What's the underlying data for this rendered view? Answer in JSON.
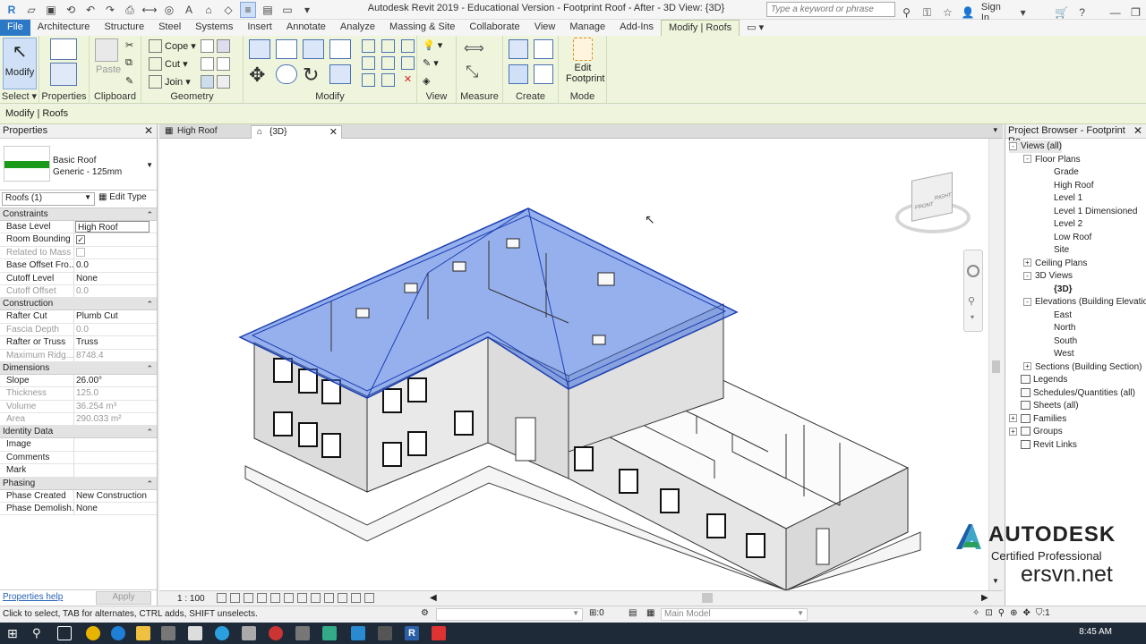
{
  "title_bar": {
    "title": "Autodesk Revit 2019 - Educational Version - Footprint Roof - After - 3D View: {3D}",
    "search_placeholder": "Type a keyword or phrase",
    "sign_in": "Sign In"
  },
  "ribbon_tabs": [
    "File",
    "Architecture",
    "Structure",
    "Steel",
    "Systems",
    "Insert",
    "Annotate",
    "Analyze",
    "Massing & Site",
    "Collaborate",
    "View",
    "Manage",
    "Add-Ins",
    "Modify | Roofs"
  ],
  "ribbon": {
    "modify_label": "Modify",
    "select_label": "Select",
    "properties_label": "Properties",
    "paste_label": "Paste",
    "clipboard_label": "Clipboard",
    "cope_label": "Cope",
    "cut_label": "Cut",
    "join_label": "Join",
    "geometry_label": "Geometry",
    "modify_panel_label": "Modify",
    "view_label": "View",
    "measure_label": "Measure",
    "create_label": "Create",
    "edit_footprint_label": "Edit Footprint",
    "mode_label": "Mode"
  },
  "options_bar": {
    "context": "Modify | Roofs"
  },
  "properties": {
    "title": "Properties",
    "type_family": "Basic Roof",
    "type_name": "Generic - 125mm",
    "instance_selector": "Roofs (1)",
    "edit_type": "Edit Type",
    "help_link": "Properties help",
    "apply": "Apply",
    "groups": [
      {
        "name": "Constraints",
        "rows": [
          {
            "key": "Base Level",
            "value": "High Roof",
            "dim": false,
            "edit": true
          },
          {
            "key": "Room Bounding",
            "value": "",
            "check": "on",
            "dim": false
          },
          {
            "key": "Related to Mass",
            "value": "",
            "check": "off",
            "dim": true
          },
          {
            "key": "Base Offset Fro...",
            "value": "0.0",
            "dim": false
          },
          {
            "key": "Cutoff Level",
            "value": "None",
            "dim": false
          },
          {
            "key": "Cutoff Offset",
            "value": "0.0",
            "dim": true
          }
        ]
      },
      {
        "name": "Construction",
        "rows": [
          {
            "key": "Rafter Cut",
            "value": "Plumb Cut",
            "dim": false
          },
          {
            "key": "Fascia Depth",
            "value": "0.0",
            "dim": true
          },
          {
            "key": "Rafter or Truss",
            "value": "Truss",
            "dim": false
          },
          {
            "key": "Maximum Ridg...",
            "value": "8748.4",
            "dim": true
          }
        ]
      },
      {
        "name": "Dimensions",
        "rows": [
          {
            "key": "Slope",
            "value": "26.00°",
            "dim": false
          },
          {
            "key": "Thickness",
            "value": "125.0",
            "dim": true
          },
          {
            "key": "Volume",
            "value": "36.254 m³",
            "dim": true
          },
          {
            "key": "Area",
            "value": "290.033 m²",
            "dim": true
          }
        ]
      },
      {
        "name": "Identity Data",
        "rows": [
          {
            "key": "Image",
            "value": "",
            "dim": false
          },
          {
            "key": "Comments",
            "value": "",
            "dim": false
          },
          {
            "key": "Mark",
            "value": "",
            "dim": false
          }
        ]
      },
      {
        "name": "Phasing",
        "rows": [
          {
            "key": "Phase Created",
            "value": "New Construction",
            "dim": false
          },
          {
            "key": "Phase Demolish...",
            "value": "None",
            "dim": false
          }
        ]
      }
    ]
  },
  "view_tabs": [
    {
      "label": "High Roof",
      "active": false
    },
    {
      "label": "{3D}",
      "active": true
    }
  ],
  "view_controls": {
    "scale": "1 : 100"
  },
  "viewcube": {
    "front": "FRONT",
    "right": "RIGHT"
  },
  "project_browser": {
    "title": "Project Browser - Footprint Ro...",
    "items": [
      {
        "label": "Views (all)",
        "level": 0,
        "pm": "-",
        "sel": true
      },
      {
        "label": "Floor Plans",
        "level": 1,
        "pm": "-"
      },
      {
        "label": "Grade",
        "level": 2
      },
      {
        "label": "High Roof",
        "level": 2
      },
      {
        "label": "Level 1",
        "level": 2
      },
      {
        "label": "Level 1 Dimensioned",
        "level": 2
      },
      {
        "label": "Level 2",
        "level": 2
      },
      {
        "label": "Low Roof",
        "level": 2
      },
      {
        "label": "Site",
        "level": 2
      },
      {
        "label": "Ceiling Plans",
        "level": 1,
        "pm": "+"
      },
      {
        "label": "3D Views",
        "level": 1,
        "pm": "-"
      },
      {
        "label": "{3D}",
        "level": 2,
        "bold": true
      },
      {
        "label": "Elevations (Building Elevation)",
        "level": 1,
        "pm": "-"
      },
      {
        "label": "East",
        "level": 2
      },
      {
        "label": "North",
        "level": 2
      },
      {
        "label": "South",
        "level": 2
      },
      {
        "label": "West",
        "level": 2
      },
      {
        "label": "Sections (Building Section)",
        "level": 1,
        "pm": "+"
      },
      {
        "label": "Legends",
        "level": 0,
        "icon": true
      },
      {
        "label": "Schedules/Quantities (all)",
        "level": 0,
        "icon": true
      },
      {
        "label": "Sheets (all)",
        "level": 0,
        "icon": true
      },
      {
        "label": "Families",
        "level": 0,
        "pm": "+",
        "icon": true
      },
      {
        "label": "Groups",
        "level": 0,
        "pm": "+",
        "icon": true
      },
      {
        "label": "Revit Links",
        "level": 0,
        "icon": true
      }
    ]
  },
  "status_bar": {
    "text": "Click to select, TAB for alternates, CTRL adds, SHIFT unselects.",
    "selection_count": ":0",
    "model": "Main Model",
    "filter": ":1"
  },
  "taskbar": {
    "clock": "8:45 AM"
  },
  "watermark": {
    "brand": "AUTODESK",
    "subtitle": "Certified Professional",
    "site": "ersvn.net"
  },
  "colors": {
    "ribbon_bg": "#eef5dc",
    "file_tab": "#2b78c7",
    "roof_highlight": "#3f6fe0",
    "type_swatch": "#1a9a1a"
  }
}
